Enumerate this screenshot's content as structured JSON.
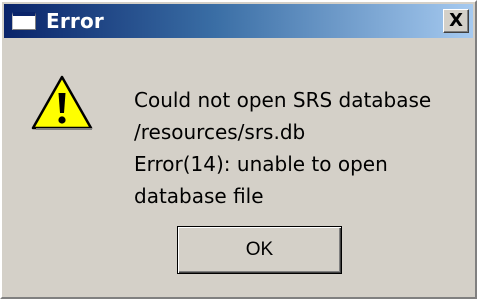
{
  "window": {
    "title": "Error",
    "close_glyph": "X",
    "title_icon": "window-icon",
    "title_bar_color": "#0a246a",
    "background_color": "#d4d0c8"
  },
  "dialog": {
    "icon": "warning-icon",
    "message_lines": [
      "Could not open SRS database",
      "/resources/srs.db",
      "Error(14): unable to open",
      "database file"
    ],
    "ok_label": "OK"
  }
}
